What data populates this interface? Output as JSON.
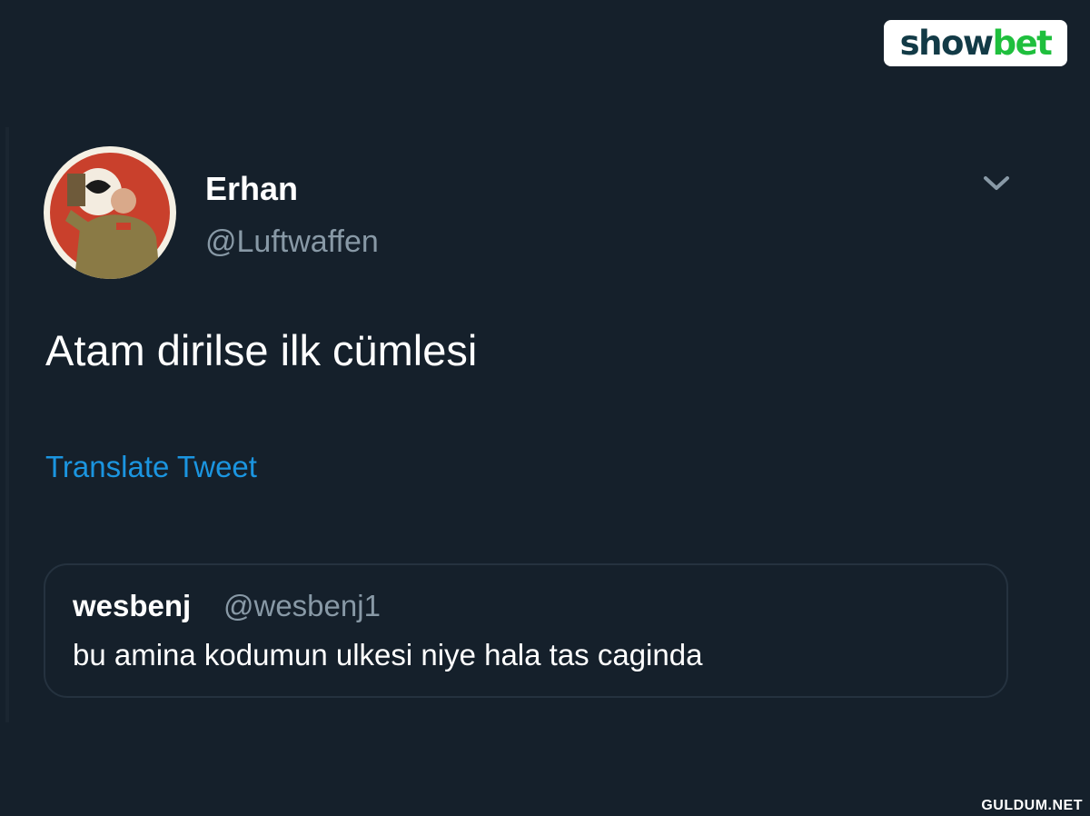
{
  "brand": {
    "logo_part1": "show",
    "logo_part2": "bet"
  },
  "tweet": {
    "display_name": "Erhan",
    "handle": "@Luftwaffen",
    "text": "Atam dirilse ilk cümlesi",
    "translate_label": "Translate Tweet",
    "menu_icon": "chevron-down-icon"
  },
  "quoted_tweet": {
    "display_name": "wesbenj",
    "handle": "@wesbenj1",
    "text": "bu amina kodumun ulkesi niye hala tas caginda"
  },
  "watermark": "GULDUM.NET",
  "colors": {
    "background": "#15202b",
    "secondary_text": "#8899a6",
    "link": "#1b95e0",
    "logo_dark": "#123a46",
    "logo_green": "#1fbf3d"
  }
}
